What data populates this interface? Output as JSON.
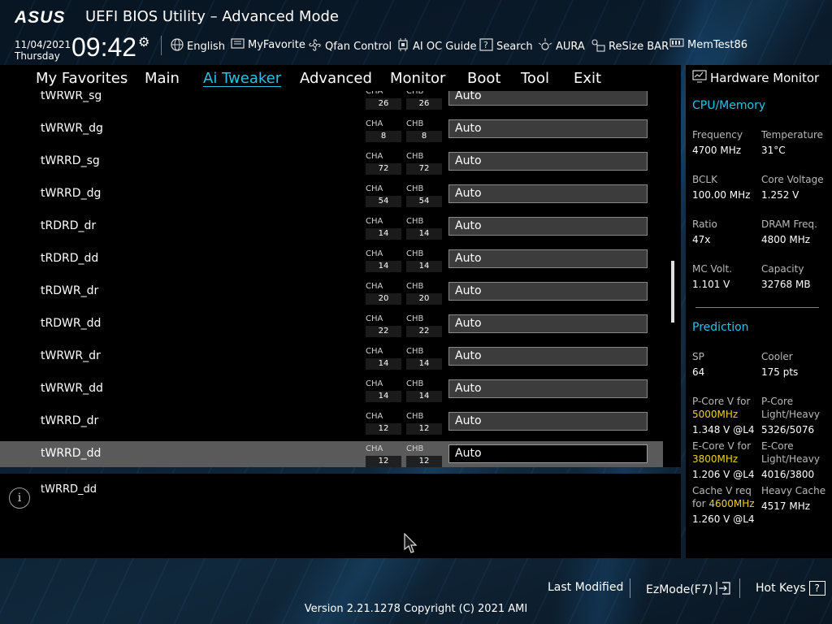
{
  "header": {
    "logo_text": "ASUS",
    "title": "UEFI BIOS Utility – Advanced Mode",
    "date": "11/04/2021",
    "weekday": "Thursday",
    "time": "09:42",
    "tools": [
      {
        "icon": "globe-icon",
        "label": "English"
      },
      {
        "icon": "favorite-icon",
        "label": "MyFavorite"
      },
      {
        "icon": "fan-icon",
        "label": "Qfan Control"
      },
      {
        "icon": "ai-oc-icon",
        "label": "AI OC Guide"
      },
      {
        "icon": "search-icon",
        "label": "Search"
      },
      {
        "icon": "aura-icon",
        "label": "AURA"
      },
      {
        "icon": "resize-bar-icon",
        "label": "ReSize BAR"
      },
      {
        "icon": "memtest-icon",
        "label": "MemTest86"
      }
    ]
  },
  "menu": {
    "items": [
      "My Favorites",
      "Main",
      "Ai Tweaker",
      "Advanced",
      "Monitor",
      "Boot",
      "Tool",
      "Exit"
    ],
    "active": "Ai Tweaker"
  },
  "settings": {
    "channel_a_label": "CHA",
    "channel_b_label": "CHB",
    "rows": [
      {
        "label": "tWRWR_sg",
        "cha": "26",
        "chb": "26",
        "value": "Auto"
      },
      {
        "label": "tWRWR_dg",
        "cha": "8",
        "chb": "8",
        "value": "Auto"
      },
      {
        "label": "tWRRD_sg",
        "cha": "72",
        "chb": "72",
        "value": "Auto"
      },
      {
        "label": "tWRRD_dg",
        "cha": "54",
        "chb": "54",
        "value": "Auto"
      },
      {
        "label": "tRDRD_dr",
        "cha": "14",
        "chb": "14",
        "value": "Auto"
      },
      {
        "label": "tRDRD_dd",
        "cha": "14",
        "chb": "14",
        "value": "Auto"
      },
      {
        "label": "tRDWR_dr",
        "cha": "20",
        "chb": "20",
        "value": "Auto"
      },
      {
        "label": "tRDWR_dd",
        "cha": "22",
        "chb": "22",
        "value": "Auto"
      },
      {
        "label": "tWRWR_dr",
        "cha": "14",
        "chb": "14",
        "value": "Auto"
      },
      {
        "label": "tWRWR_dd",
        "cha": "14",
        "chb": "14",
        "value": "Auto"
      },
      {
        "label": "tWRRD_dr",
        "cha": "12",
        "chb": "12",
        "value": "Auto"
      },
      {
        "label": "tWRRD_dd",
        "cha": "12",
        "chb": "12",
        "value": "Auto"
      }
    ],
    "selected_index": 11
  },
  "help": {
    "text": "tWRRD_dd"
  },
  "hardware_monitor": {
    "title": "Hardware Monitor",
    "cpu_memory_title": "CPU/Memory",
    "frequency_label": "Frequency",
    "frequency_value": "4700 MHz",
    "temperature_label": "Temperature",
    "temperature_value": "31°C",
    "bclk_label": "BCLK",
    "bclk_value": "100.00 MHz",
    "core_voltage_label": "Core Voltage",
    "core_voltage_value": "1.252 V",
    "ratio_label": "Ratio",
    "ratio_value": "47x",
    "dram_freq_label": "DRAM Freq.",
    "dram_freq_value": "4800 MHz",
    "mc_volt_label": "MC Volt.",
    "mc_volt_value": "1.101 V",
    "capacity_label": "Capacity",
    "capacity_value": "32768 MB",
    "prediction_title": "Prediction",
    "sp_label": "SP",
    "sp_value": "64",
    "cooler_label": "Cooler",
    "cooler_value": "175 pts",
    "pcore_v_label": "P-Core V for",
    "pcore_v_freq": "5000MHz",
    "pcore_v_value": "1.348 V @L4",
    "pcore_lh_label1": "P-Core",
    "pcore_lh_label2": "Light/Heavy",
    "pcore_lh_value": "5326/5076",
    "ecore_v_label": "E-Core V for",
    "ecore_v_freq": "3800MHz",
    "ecore_v_value": "1.206 V @L4",
    "ecore_lh_label1": "E-Core",
    "ecore_lh_label2": "Light/Heavy",
    "ecore_lh_value": "4016/3800",
    "cache_v_label1": "Cache V req",
    "cache_v_label2": "for",
    "cache_v_freq": "4600MHz",
    "cache_v_value": "1.260 V @L4",
    "heavy_cache_label": "Heavy Cache",
    "heavy_cache_value": "4517 MHz"
  },
  "footer": {
    "last_modified": "Last Modified",
    "ezmode": "EzMode(F7)",
    "hot_keys": "Hot Keys",
    "hot_keys_key": "?",
    "version": "Version 2.21.1278 Copyright (C) 2021 AMI"
  },
  "colors": {
    "accent": "#28c4e8",
    "highlight": "#f0d020",
    "selected_row": "#5a5a5a"
  }
}
